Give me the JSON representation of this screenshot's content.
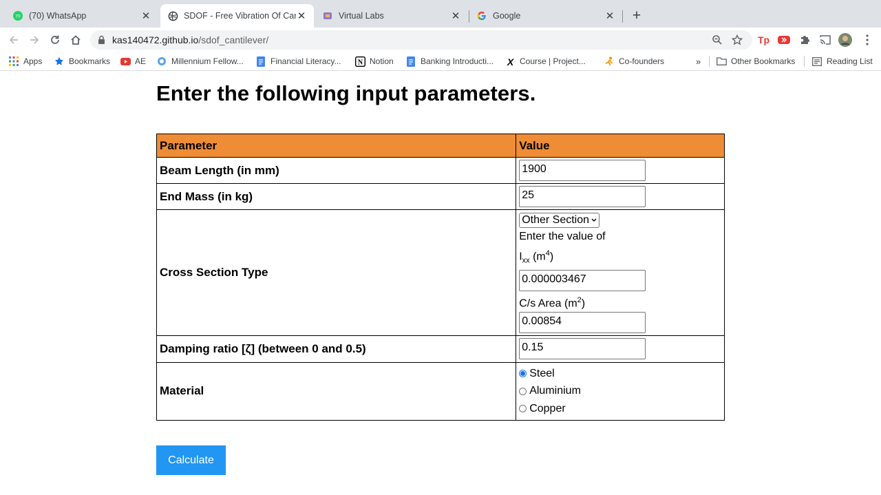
{
  "browser": {
    "tabs": [
      {
        "title": "(70) WhatsApp",
        "badge": "70",
        "active": false
      },
      {
        "title": "SDOF - Free Vibration Of Canti",
        "active": true
      },
      {
        "title": "Virtual Labs",
        "active": false
      },
      {
        "title": "Google",
        "active": false
      }
    ],
    "new_tab_label": "+",
    "url_host": "kas140472.github.io",
    "url_path": "/sdof_cantilever/",
    "bookmarks": [
      {
        "label": "Apps",
        "icon": "apps-grid-icon"
      },
      {
        "label": "Bookmarks",
        "icon": "star-icon"
      },
      {
        "label": "AE",
        "icon": "youtube-icon"
      },
      {
        "label": "Millennium Fellow...",
        "icon": "globe-icon"
      },
      {
        "label": "Financial Literacy...",
        "icon": "docs-icon"
      },
      {
        "label": "Notion",
        "icon": "notion-icon"
      },
      {
        "label": "Banking Introducti...",
        "icon": "docs-icon"
      },
      {
        "label": "Course | Project...",
        "icon": "x-logo-icon"
      },
      {
        "label": "Co-founders",
        "icon": "runner-icon"
      }
    ],
    "more_bookmarks": "»",
    "other_bookmarks": "Other Bookmarks",
    "reading_list": "Reading List"
  },
  "page": {
    "heading": "Enter the following input parameters.",
    "table": {
      "header_param": "Parameter",
      "header_value": "Value",
      "beam_length_label": "Beam Length (in mm)",
      "beam_length_value": "1900",
      "end_mass_label": "End Mass (in kg)",
      "end_mass_value": "25",
      "cross_section_label": "Cross Section Type",
      "cross_section_selected": "Other Section",
      "ixx_prompt": "Enter the value of",
      "ixx_symbol": "I",
      "ixx_subscript": "xx",
      "ixx_unit_open": " (m",
      "ixx_unit_power": "4",
      "ixx_unit_close": ")",
      "ixx_value": "0.000003467",
      "area_label": "C/s Area (m",
      "area_power": "2",
      "area_close": ")",
      "area_value": "0.00854",
      "damping_label": "Damping ratio [ζ] (between 0 and 0.5)",
      "damping_value": "0.15",
      "material_label": "Material",
      "materials": [
        "Steel",
        "Aluminium",
        "Copper"
      ],
      "material_selected": "Steel"
    },
    "calculate_label": "Calculate"
  },
  "colors": {
    "table_header": "#ef8c36",
    "button": "#2196f3",
    "radio_checked": "#1a73e8"
  }
}
